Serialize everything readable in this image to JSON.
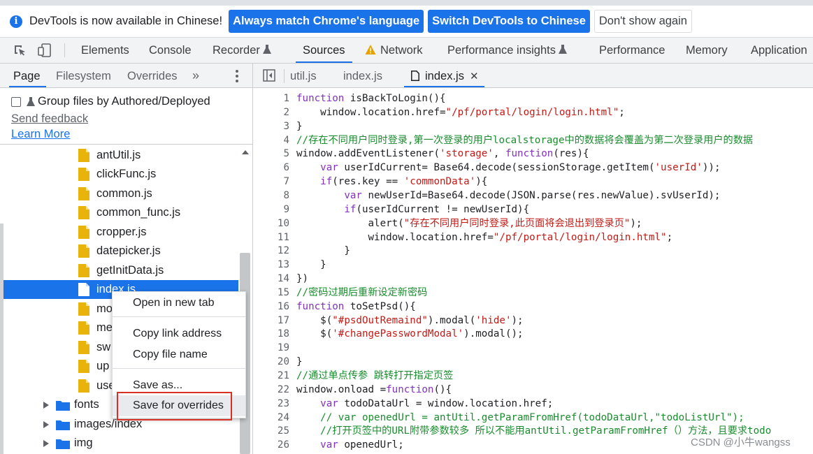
{
  "infobar": {
    "message": "DevTools is now available in Chinese!",
    "btn_always": "Always match Chrome's language",
    "btn_switch": "Switch DevTools to Chinese",
    "btn_dismiss": "Don't show again"
  },
  "main_tabs": [
    "Elements",
    "Console",
    "Recorder",
    "Sources",
    "Network",
    "Performance insights",
    "Performance",
    "Memory",
    "Application"
  ],
  "active_main_tab": "Sources",
  "navigator": {
    "tabs": [
      "Page",
      "Filesystem",
      "Overrides"
    ],
    "more": "»",
    "group_label": "Group files by Authored/Deployed",
    "send_feedback": "Send feedback",
    "learn_more": "Learn More",
    "files": [
      "antUtil.js",
      "clickFunc.js",
      "common.js",
      "common_func.js",
      "cropper.js",
      "datepicker.js",
      "getInitData.js",
      "index.js",
      "mo",
      "me",
      "sw",
      "up",
      "use"
    ],
    "selected_file": "index.js",
    "folders": [
      "fonts",
      "images/index",
      "img"
    ]
  },
  "code_tabs": [
    "util.js",
    "index.js",
    "index.js"
  ],
  "code_lines": [
    {
      "n": "1",
      "t": [
        {
          "k": "kw",
          "v": "function"
        },
        {
          "k": "plain",
          "v": " isBackToLogin(){"
        }
      ]
    },
    {
      "n": "2",
      "t": [
        {
          "k": "plain",
          "v": "    window.location.href="
        },
        {
          "k": "str",
          "v": "\"/pf/portal/login/login.html\""
        },
        {
          "k": "plain",
          "v": ";"
        }
      ]
    },
    {
      "n": "3",
      "t": [
        {
          "k": "plain",
          "v": "}"
        }
      ]
    },
    {
      "n": "4",
      "t": [
        {
          "k": "com",
          "v": "//存在不同用户同时登录,第一次登录的用户localstorage中的数据将会覆盖为第二次登录用户的数据"
        }
      ]
    },
    {
      "n": "5",
      "t": [
        {
          "k": "plain",
          "v": "window.addEventListener("
        },
        {
          "k": "str",
          "v": "'storage'"
        },
        {
          "k": "plain",
          "v": ", "
        },
        {
          "k": "kw",
          "v": "function"
        },
        {
          "k": "plain",
          "v": "(res){"
        }
      ]
    },
    {
      "n": "6",
      "t": [
        {
          "k": "plain",
          "v": "    "
        },
        {
          "k": "kw",
          "v": "var"
        },
        {
          "k": "plain",
          "v": " userIdCurrent= Base64.decode(sessionStorage.getItem("
        },
        {
          "k": "str",
          "v": "'userId'"
        },
        {
          "k": "plain",
          "v": "));"
        }
      ]
    },
    {
      "n": "7",
      "t": [
        {
          "k": "plain",
          "v": "    "
        },
        {
          "k": "kw",
          "v": "if"
        },
        {
          "k": "plain",
          "v": "(res.key == "
        },
        {
          "k": "str",
          "v": "'commonData'"
        },
        {
          "k": "plain",
          "v": "){"
        }
      ]
    },
    {
      "n": "8",
      "t": [
        {
          "k": "plain",
          "v": "        "
        },
        {
          "k": "kw",
          "v": "var"
        },
        {
          "k": "plain",
          "v": " newUserId=Base64.decode(JSON.parse(res.newValue).svUserId);"
        }
      ]
    },
    {
      "n": "9",
      "t": [
        {
          "k": "plain",
          "v": "        "
        },
        {
          "k": "kw",
          "v": "if"
        },
        {
          "k": "plain",
          "v": "(userIdCurrent != newUserId){"
        }
      ]
    },
    {
      "n": "10",
      "t": [
        {
          "k": "plain",
          "v": "            alert("
        },
        {
          "k": "str",
          "v": "\"存在不同用户同时登录,此页面将会退出到登录页\""
        },
        {
          "k": "plain",
          "v": ");"
        }
      ]
    },
    {
      "n": "11",
      "t": [
        {
          "k": "plain",
          "v": "            window.location.href="
        },
        {
          "k": "str",
          "v": "\"/pf/portal/login/login.html\""
        },
        {
          "k": "plain",
          "v": ";"
        }
      ]
    },
    {
      "n": "12",
      "t": [
        {
          "k": "plain",
          "v": "        }"
        }
      ]
    },
    {
      "n": "13",
      "t": [
        {
          "k": "plain",
          "v": "    }"
        }
      ]
    },
    {
      "n": "14",
      "t": [
        {
          "k": "plain",
          "v": "})"
        }
      ]
    },
    {
      "n": "15",
      "t": [
        {
          "k": "com",
          "v": "//密码过期后重新设定新密码"
        }
      ]
    },
    {
      "n": "16",
      "t": [
        {
          "k": "kw",
          "v": "function"
        },
        {
          "k": "plain",
          "v": " toSetPsd(){"
        }
      ]
    },
    {
      "n": "17",
      "t": [
        {
          "k": "plain",
          "v": "    $("
        },
        {
          "k": "str",
          "v": "\"#psdOutRemaind\""
        },
        {
          "k": "plain",
          "v": ").modal("
        },
        {
          "k": "str",
          "v": "'hide'"
        },
        {
          "k": "plain",
          "v": ");"
        }
      ]
    },
    {
      "n": "18",
      "t": [
        {
          "k": "plain",
          "v": "    $("
        },
        {
          "k": "str",
          "v": "'#changePasswordModal'"
        },
        {
          "k": "plain",
          "v": ").modal();"
        }
      ]
    },
    {
      "n": "19",
      "t": []
    },
    {
      "n": "20",
      "t": [
        {
          "k": "plain",
          "v": "}"
        }
      ]
    },
    {
      "n": "21",
      "t": [
        {
          "k": "com",
          "v": "//通过单点传参 跳转打开指定页签"
        }
      ]
    },
    {
      "n": "22",
      "t": [
        {
          "k": "plain",
          "v": "window.onload ="
        },
        {
          "k": "kw",
          "v": "function"
        },
        {
          "k": "plain",
          "v": "(){"
        }
      ]
    },
    {
      "n": "23",
      "t": [
        {
          "k": "plain",
          "v": "    "
        },
        {
          "k": "kw",
          "v": "var"
        },
        {
          "k": "plain",
          "v": " todoDataUrl = window.location.href;"
        }
      ]
    },
    {
      "n": "24",
      "t": [
        {
          "k": "com",
          "v": "    // var openedUrl = antUtil.getParamFromHref(todoDataUrl,\"todoListUrl\");"
        }
      ]
    },
    {
      "n": "25",
      "t": [
        {
          "k": "com",
          "v": "    //打开页签中的URL附带参数较多 所以不能用antUtil.getParamFromHref（）方法，且要求todo"
        }
      ]
    },
    {
      "n": "26",
      "t": [
        {
          "k": "plain",
          "v": "    "
        },
        {
          "k": "kw",
          "v": "var"
        },
        {
          "k": "plain",
          "v": " openedUrl;"
        }
      ]
    }
  ],
  "context_menu": {
    "open_new_tab": "Open in new tab",
    "copy_link": "Copy link address",
    "copy_name": "Copy file name",
    "save_as": "Save as...",
    "save_overrides": "Save for overrides"
  },
  "watermark": "CSDN @小牛wangss",
  "colors": {
    "accent": "#1a73e8",
    "file_icon": "#e8b40b",
    "highlight": "#d93025",
    "keyword": "#8430c2",
    "string": "#c41a16",
    "comment": "#1a8c2e"
  }
}
